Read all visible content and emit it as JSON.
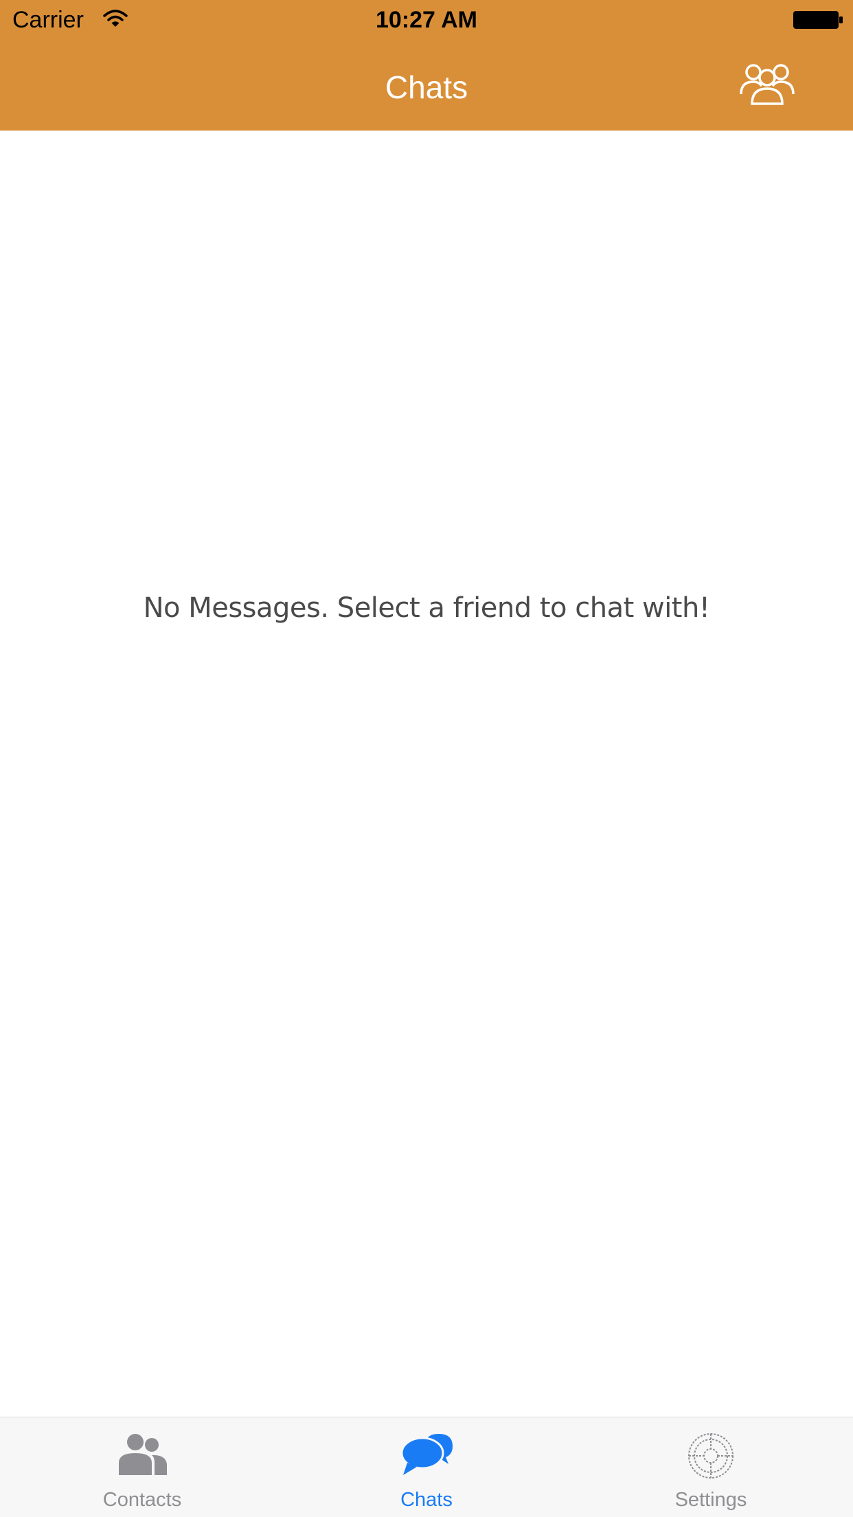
{
  "status_bar": {
    "carrier": "Carrier",
    "time": "10:27 AM"
  },
  "nav_bar": {
    "title": "Chats",
    "right_icon": "group-icon"
  },
  "main": {
    "empty_message": "No Messages. Select a friend to chat with!"
  },
  "tab_bar": {
    "tabs": [
      {
        "label": "Contacts",
        "icon": "contacts-icon",
        "selected": false
      },
      {
        "label": "Chats",
        "icon": "chat-bubbles-icon",
        "selected": true
      },
      {
        "label": "Settings",
        "icon": "settings-icon",
        "selected": false
      }
    ]
  },
  "colors": {
    "nav_background": "#d98f38",
    "active_tab": "#1a7cf5",
    "inactive_tab": "#8e8e93"
  }
}
